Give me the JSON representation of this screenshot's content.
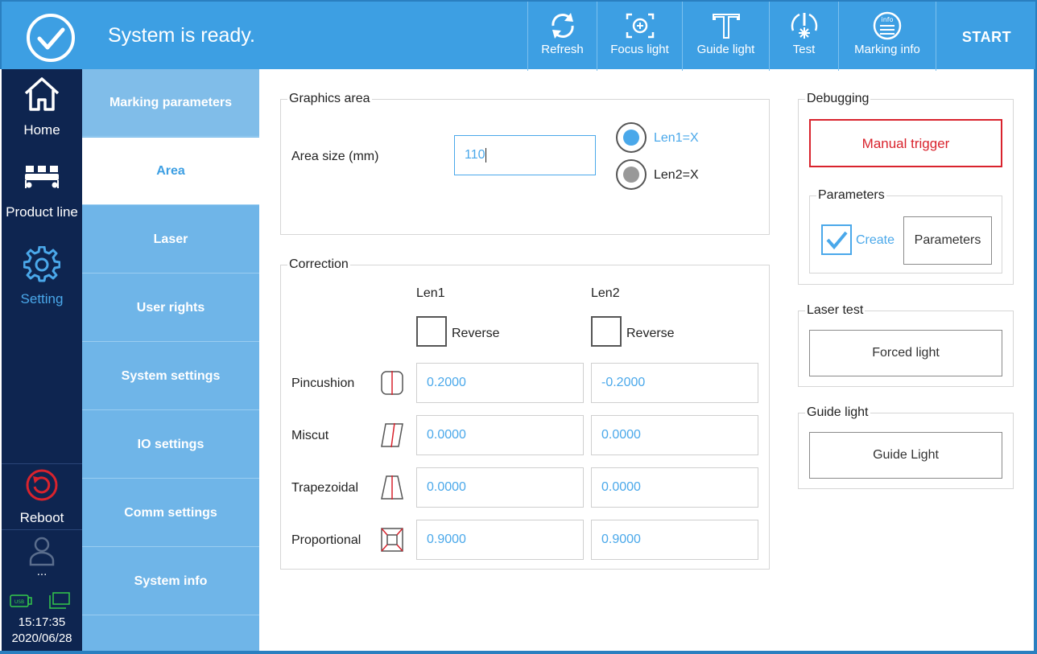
{
  "topbar": {
    "status_text": "System is ready.",
    "buttons": [
      {
        "label": "Refresh",
        "icon": "refresh-icon"
      },
      {
        "label": "Focus light",
        "icon": "focus-light-icon"
      },
      {
        "label": "Guide light",
        "icon": "guide-light-icon"
      },
      {
        "label": "Test",
        "icon": "test-icon"
      },
      {
        "label": "Marking info",
        "icon": "marking-info-icon"
      }
    ],
    "start_label": "START"
  },
  "leftnav": {
    "items": [
      {
        "label": "Home",
        "icon": "home-icon"
      },
      {
        "label": "Product line",
        "icon": "product-line-icon"
      },
      {
        "label": "Setting",
        "icon": "gear-icon",
        "active": true
      },
      {
        "label": "Reboot",
        "icon": "reboot-icon"
      },
      {
        "label": "...",
        "icon": "user-icon"
      }
    ],
    "time": "15:17:35",
    "date": "2020/06/28"
  },
  "subnav": {
    "items": [
      "Marking parameters",
      "Area",
      "Laser",
      "User rights",
      "System settings",
      "IO settings",
      "Comm settings",
      "System info"
    ],
    "active": "Area"
  },
  "graphics_area": {
    "title": "Graphics area",
    "area_size_label": "Area size (mm)",
    "area_size_value": "110",
    "radio_len1": "Len1=X",
    "radio_len2": "Len2=X"
  },
  "correction": {
    "title": "Correction",
    "col_len1": "Len1",
    "col_len2": "Len2",
    "reverse_label": "Reverse",
    "rows": [
      {
        "label": "Pincushion",
        "len1": "0.2000",
        "len2": "-0.2000"
      },
      {
        "label": "Miscut",
        "len1": "0.0000",
        "len2": "0.0000"
      },
      {
        "label": "Trapezoidal",
        "len1": "0.0000",
        "len2": "0.0000"
      },
      {
        "label": "Proportional",
        "len1": "0.9000",
        "len2": "0.9000"
      }
    ]
  },
  "debugging": {
    "title": "Debugging",
    "manual_trigger": "Manual trigger",
    "parameters_title": "Parameters",
    "create_label": "Create",
    "parameters_button": "Parameters"
  },
  "laser_test": {
    "title": "Laser test",
    "button": "Forced light"
  },
  "guide_light": {
    "title": "Guide light",
    "button": "Guide Light"
  },
  "colors": {
    "accent": "#3d9fe3",
    "nav_dark": "#0e2550",
    "subnav": "#6fb5e8",
    "danger": "#d9232d"
  }
}
